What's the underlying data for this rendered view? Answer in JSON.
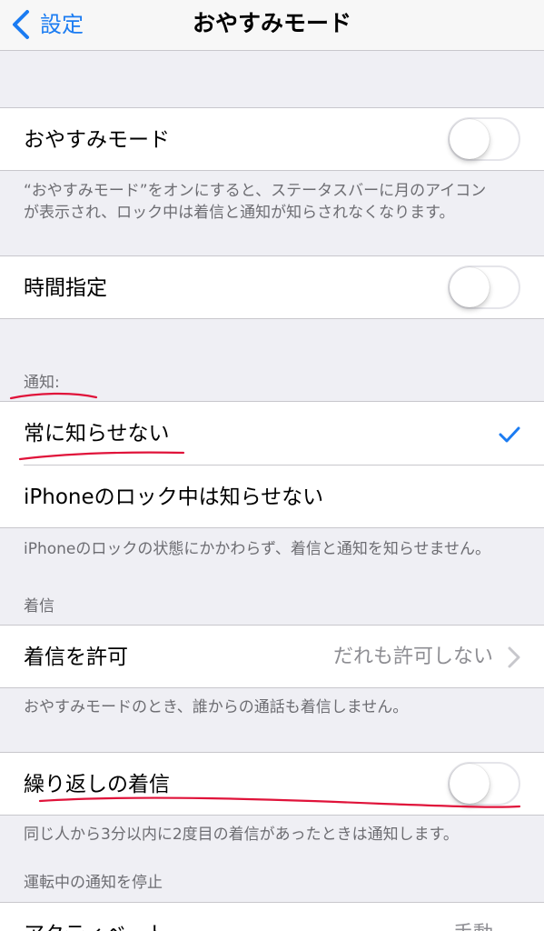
{
  "nav": {
    "back_label": "設定",
    "title": "おやすみモード"
  },
  "dnd": {
    "label": "おやすみモード",
    "enabled": false,
    "footer_line1": "“おやすみモード”をオンにすると、ステータスバーに月のアイコン",
    "footer_line2": "が表示され、ロック中は着信と通知が知らされなくなります。"
  },
  "scheduled": {
    "label": "時間指定",
    "enabled": false
  },
  "notifications": {
    "header": "通知:",
    "options": [
      {
        "label": "常に知らせない",
        "selected": true
      },
      {
        "label": "iPhoneのロック中は知らせない",
        "selected": false
      }
    ],
    "footer": "iPhoneのロックの状態にかかわらず、着信と通知を知らせません。"
  },
  "calls": {
    "header": "着信",
    "allow_label": "着信を許可",
    "allow_value": "だれも許可しない",
    "footer": "おやすみモードのとき、誰からの通話も着信しません。"
  },
  "repeated": {
    "label": "繰り返しの着信",
    "enabled": false,
    "footer": "同じ人から3分以内に2度目の着信があったときは通知します。"
  },
  "driving": {
    "header": "運転中の通知を停止",
    "activate_label": "アクティベート",
    "activate_value": "手動"
  },
  "colors": {
    "accent": "#1b7cf2",
    "annotation": "#e0133a"
  }
}
